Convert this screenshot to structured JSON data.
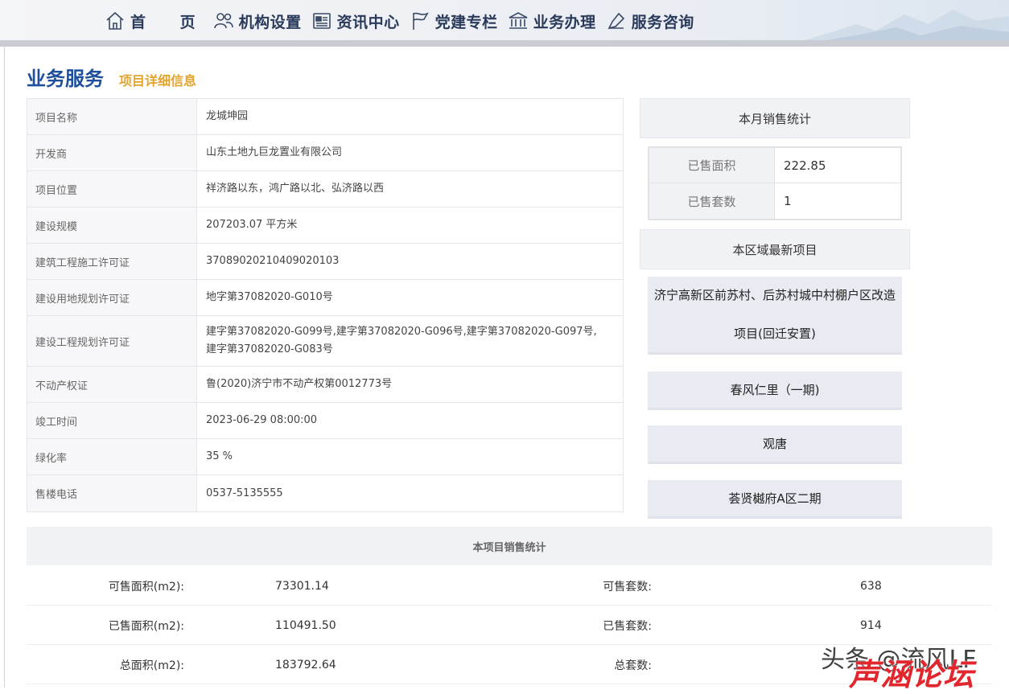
{
  "nav": [
    {
      "label": "首 页",
      "icon": "home-icon"
    },
    {
      "label": "机构设置",
      "icon": "people-icon"
    },
    {
      "label": "资讯中心",
      "icon": "news-icon"
    },
    {
      "label": "党建专栏",
      "icon": "flag-icon"
    },
    {
      "label": "业务办理",
      "icon": "bank-icon"
    },
    {
      "label": "服务咨询",
      "icon": "consult-icon"
    }
  ],
  "page": {
    "title": "业务服务",
    "subtitle": "项目详细信息"
  },
  "info": [
    {
      "key": "项目名称",
      "value": "龙城坤园"
    },
    {
      "key": "开发商",
      "value": "山东土地九巨龙置业有限公司"
    },
    {
      "key": "项目位置",
      "value": "祥济路以东，鸿广路以北、弘济路以西"
    },
    {
      "key": "建设规模",
      "value": "207203.07 平方米"
    },
    {
      "key": "建筑工程施工许可证",
      "value": "370890202104090201​03"
    },
    {
      "key": "建设用地规划许可证",
      "value": "地字第37082020-G010号"
    },
    {
      "key": "建设工程规划许可证",
      "value": "建字第37082020-G099号,建字第37082020-G096号,建字第37082020-G097号,\n建字第37082020-G083号"
    },
    {
      "key": "不动产权证",
      "value": "鲁(2020)济宁市不动产权第0012773号"
    },
    {
      "key": "竣工时间",
      "value": "2023-06-29 08:00:00"
    },
    {
      "key": "绿化率",
      "value": "35 %"
    },
    {
      "key": "售楼电话",
      "value": "0537-5135555"
    }
  ],
  "monthly": {
    "title": "本月销售统计",
    "rows": [
      {
        "key": "已售面积",
        "value": "222.85"
      },
      {
        "key": "已售套数",
        "value": "1"
      }
    ]
  },
  "latest": {
    "title": "本区域最新项目",
    "items": [
      "济宁高新区前苏村、后苏村城中村棚户区改造项目(回迁安置)",
      "春风仁里（一期)",
      "观唐",
      "荟贤樾府A区二期"
    ]
  },
  "project_stats": {
    "title": "本项目销售统计",
    "rows": [
      {
        "l1": "可售面积(m2):",
        "v1": "73301.14",
        "l2": "可售套数:",
        "v2": "638"
      },
      {
        "l1": "已售面积(m2):",
        "v1": "110491.50",
        "l2": "已售套数:",
        "v2": "914"
      },
      {
        "l1": "总面积(m2):",
        "v1": "183792.64",
        "l2": "总套数:",
        "v2": ""
      }
    ]
  },
  "watermark": {
    "line1": "头条 @流风LF",
    "line2": "声涵论坛"
  }
}
